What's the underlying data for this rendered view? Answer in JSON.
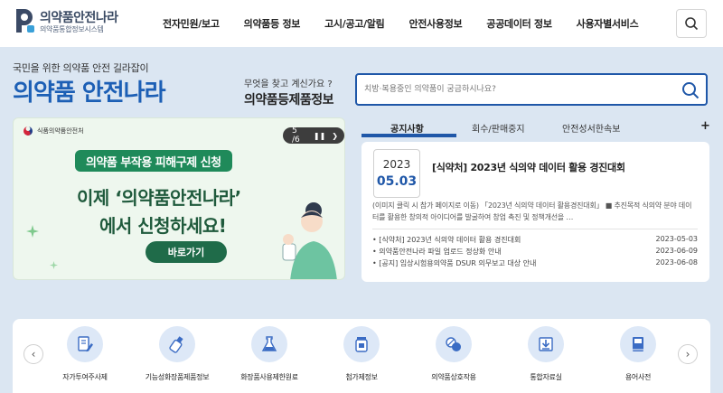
{
  "header": {
    "logo_title": "의약품안전나라",
    "logo_subtitle": "의약품통합정보시스템",
    "nav": [
      "전자민원/보고",
      "의약품등 정보",
      "고시/공고/알림",
      "안전사용정보",
      "공공데이터 정보",
      "사용자별서비스"
    ]
  },
  "hero": {
    "tagline": "국민을 위한 의약품 안전 길라잡이",
    "title": "의약품 안전나라",
    "search_question": "무엇을 찾고 계신가요 ?",
    "search_category": "의약품등제품정보",
    "search_placeholder": "치방·복용중인 의약품이 궁금하시나요?"
  },
  "banner": {
    "org": "식품의약품안전처",
    "counter": "5 /6",
    "pill": "의약품 부작용 피해구제 신청",
    "line1": "이제 ‘의약품안전나라’",
    "line2": "에서 신청하세요!",
    "cta": "바로가기"
  },
  "tabs": [
    "공지사항",
    "회수/판매중지",
    "안전성서한속보"
  ],
  "tab_more": "+",
  "featured": {
    "year": "2023",
    "month_day": "05.03",
    "title": "[식약처] 2023년 식의약 데이터 활용 경진대회",
    "description": "(이미지 클릭 시 참가 페이지로 이동) 「2023년 식의약 데이터 활용경진대회」 ■ 추진목적 식의약 분야 데이터를 활용한 창의적 아이디어를 발굴하여 창업 촉진 및 정책개선을 …"
  },
  "notices": [
    {
      "title": "[식약처] 2023년 식의약 데이터 활용 경진대회",
      "date": "2023-05-03"
    },
    {
      "title": "의약품안전나라 파일 업로드 정상화 안내",
      "date": "2023-06-09"
    },
    {
      "title": "[공지] 임상시험용의약품 DSUR 의무보고 대상 안내",
      "date": "2023-06-08"
    }
  ],
  "quick_menu": [
    "자가투여주사제",
    "기능성화장품제품정보",
    "화장품사용제한원료",
    "첨가제정보",
    "의약품상호작용",
    "통합자료실",
    "용어사전"
  ],
  "colors": {
    "brand_blue": "#1f57a8",
    "banner_green": "#1f8a5a",
    "page_bg": "#dbe6f2"
  }
}
